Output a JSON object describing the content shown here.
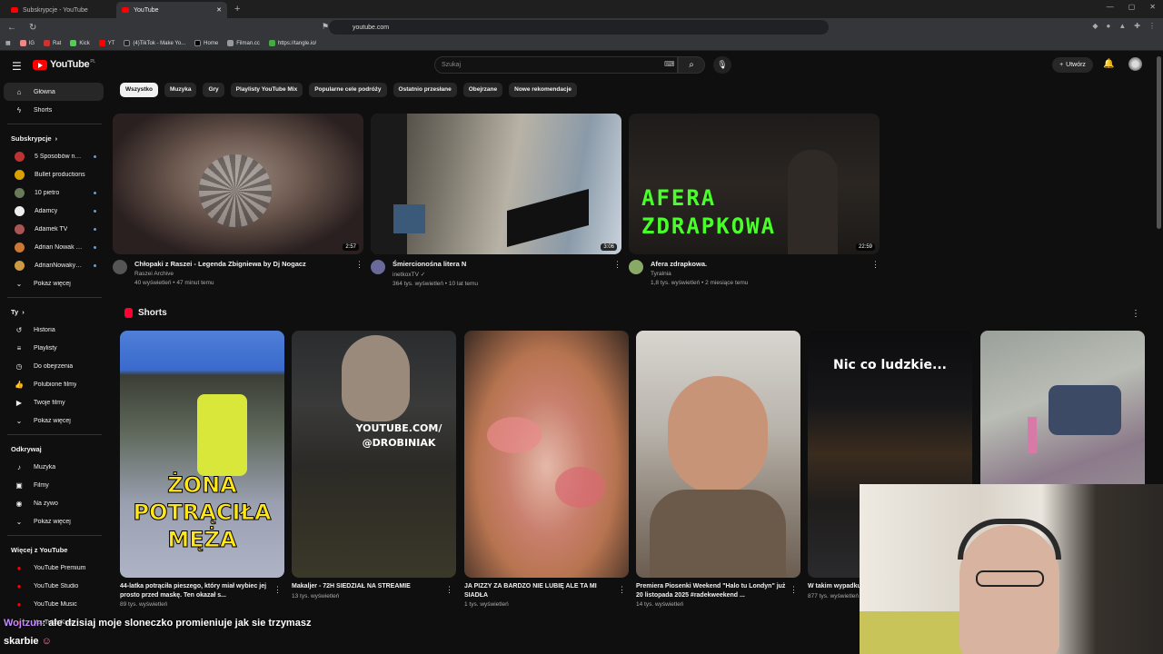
{
  "browser": {
    "tabs": [
      {
        "title": "Subskrypcje - YouTube"
      },
      {
        "title": "YouTube"
      }
    ],
    "url": "youtube.com",
    "bookmarks": [
      "IG",
      "Rat",
      "Kick",
      "YT",
      "(4)TikTok - Make Yo...",
      "Home",
      "Filman.cc",
      "https://tangle.io/"
    ]
  },
  "header": {
    "logo": "YouTube",
    "region": "PL",
    "search_placeholder": "Szukaj",
    "create_label": "Utwórz"
  },
  "sidebar": {
    "main": [
      {
        "label": "Główna",
        "icon": "home-icon"
      },
      {
        "label": "Shorts",
        "icon": "shorts-icon"
      }
    ],
    "subs_title": "Subskrypcje",
    "subs": [
      {
        "label": "5 Sposobów na...",
        "color": "#b33"
      },
      {
        "label": "Bullet productions",
        "color": "#d8a300"
      },
      {
        "label": "10 pietro",
        "color": "#6a7a5a"
      },
      {
        "label": "Adamcy",
        "color": "#eee"
      },
      {
        "label": "Adamek TV",
        "color": "#a55"
      },
      {
        "label": "Adrian Nowak Żalno",
        "color": "#c73"
      },
      {
        "label": "AdrianNowakyoutu...",
        "color": "#c94"
      }
    ],
    "subs_more": "Pokaż więcej",
    "you_title": "Ty",
    "you": [
      {
        "label": "Historia",
        "icon": "history-icon"
      },
      {
        "label": "Playlisty",
        "icon": "playlist-icon"
      },
      {
        "label": "Do obejrzenia",
        "icon": "clock-icon"
      },
      {
        "label": "Polubione filmy",
        "icon": "like-icon"
      },
      {
        "label": "Twoje filmy",
        "icon": "video-icon"
      },
      {
        "label": "Pokaż więcej",
        "icon": "chevron-down-icon"
      }
    ],
    "explore_title": "Odkrywaj",
    "explore": [
      {
        "label": "Muzyka",
        "icon": "music-icon"
      },
      {
        "label": "Filmy",
        "icon": "film-icon"
      },
      {
        "label": "Na żywo",
        "icon": "live-icon"
      },
      {
        "label": "Pokaż więcej",
        "icon": "chevron-down-icon"
      }
    ],
    "more_title": "Więcej z YouTube",
    "more": [
      {
        "label": "YouTube Premium"
      },
      {
        "label": "YouTube Studio"
      },
      {
        "label": "YouTube Music"
      },
      {
        "label": "YouTube Kids"
      }
    ]
  },
  "chips": [
    "Wszystko",
    "Muzyka",
    "Gry",
    "Playlisty YouTube Mix",
    "Popularne cele podróży",
    "Ostatnio przesłane",
    "Obejrzane",
    "Nowe rekomendacje"
  ],
  "videos": [
    {
      "title": "Chłopaki z Raszei - Legenda Zbigniewa by Dj Nogacz",
      "channel": "Raszei Archive",
      "stats": "40 wyświetleń • 47 minut temu",
      "duration": "2:57"
    },
    {
      "title": "Śmiercionośna litera N",
      "channel": "inetkoxTV",
      "stats": "364 tys. wyświetleń • 10 lat temu",
      "duration": "3:06"
    },
    {
      "title": "Afera zdrapkowa.",
      "channel": "Tyralnia",
      "stats": "1,8 tys. wyświetleń • 2 miesiące temu",
      "duration": "22:59",
      "thumb_text": "AFERA ZDRAPKOWA"
    }
  ],
  "shorts_title": "Shorts",
  "shorts": [
    {
      "title": "44-latka potrąciła pieszego, który miał wybiec jej prosto przed maskę. Ten okazał s...",
      "views": "89 tys. wyświetleń",
      "thumb_text": "ŻONA POTRĄCIŁA MĘŻA"
    },
    {
      "title": "Makaljer - 72H SIEDZIAŁ NA STREAMIE",
      "views": "13 tys. wyświetleń",
      "thumb_text": "YOUTUBE.COM/ @DROBINIAK"
    },
    {
      "title": "JA PIZZY ZA BARDZO NIE LUBIĘ ALE TA MI SIADŁA",
      "views": "1 tys. wyświetleń"
    },
    {
      "title": "Premiera Piosenki Weekend \"Halo tu Londyn\" już 20 listopada 2025 #radekweekend ...",
      "views": "14 tys. wyświetleń"
    },
    {
      "title": "W takim wypadku chyba nie?",
      "views": "877 tys. wyświetleń",
      "thumb_text": "Nic co ludzkie..."
    },
    {
      "title": "",
      "views": ""
    }
  ],
  "chat": {
    "user": "Wojtzun",
    "message": ": ale dzisiaj moje sloneczko promieniuje jak sie trzymasz",
    "message2": "skarbie"
  }
}
